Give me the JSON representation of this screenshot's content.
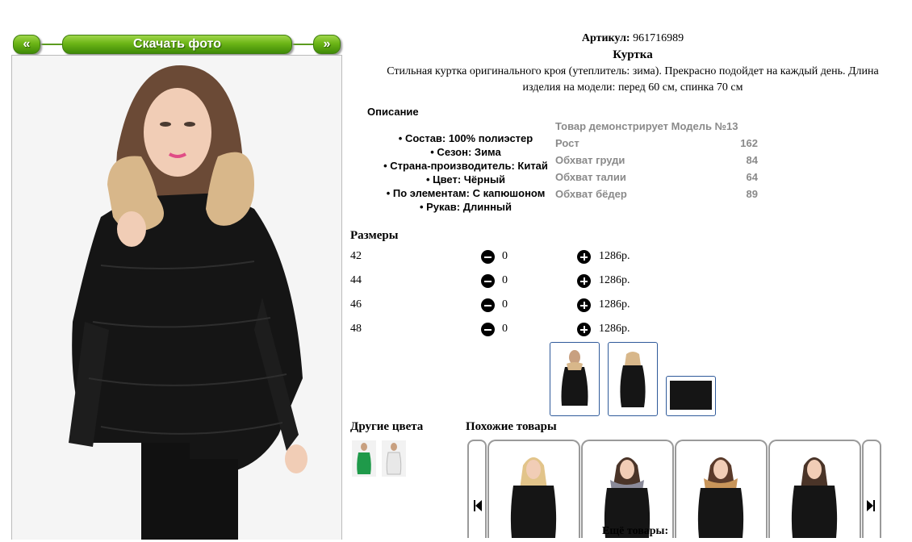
{
  "nav": {
    "prev_label": "«",
    "download_label": "Скачать фото",
    "next_label": "»"
  },
  "product": {
    "article_label": "Артикул:",
    "article_value": "961716989",
    "name": "Куртка",
    "description_line1": "Стильная куртка оригинального кроя (утеплитель: зима). Прекрасно подойдет на каждый день. Длина",
    "description_line2": "изделия на модели: перед 60 см, спинка 70 см"
  },
  "specs": {
    "title": "Описание",
    "items": [
      "• Состав: 100% полиэстер",
      "• Сезон: Зима",
      "• Страна-производитель: Китай",
      "• Цвет: Чёрный",
      "• По элементам: С капюшоном",
      "• Рукав: Длинный"
    ]
  },
  "model": {
    "title": "Товар демонстрирует Модель №13",
    "rows": [
      {
        "label": "Рост",
        "value": "162"
      },
      {
        "label": "Обхват груди",
        "value": "84"
      },
      {
        "label": "Обхват талии",
        "value": "64"
      },
      {
        "label": "Обхват бёдер",
        "value": "89"
      }
    ]
  },
  "sizes": {
    "title": "Размеры",
    "rows": [
      {
        "size": "42",
        "qty": "0",
        "price": "1286р."
      },
      {
        "size": "44",
        "qty": "0",
        "price": "1286р."
      },
      {
        "size": "46",
        "qty": "0",
        "price": "1286р."
      },
      {
        "size": "48",
        "qty": "0",
        "price": "1286р."
      }
    ]
  },
  "other_colors": {
    "title": "Другие цвета"
  },
  "similar": {
    "title": "Похожие товары"
  },
  "more": {
    "label": "Ещё товары:"
  },
  "colors": {
    "button_green": "#6cb516",
    "jacket_black": "#151515",
    "fur": "#d8b78a",
    "model_text_gray": "#8a8a8a",
    "thumb_border": "#2f5a9a"
  }
}
